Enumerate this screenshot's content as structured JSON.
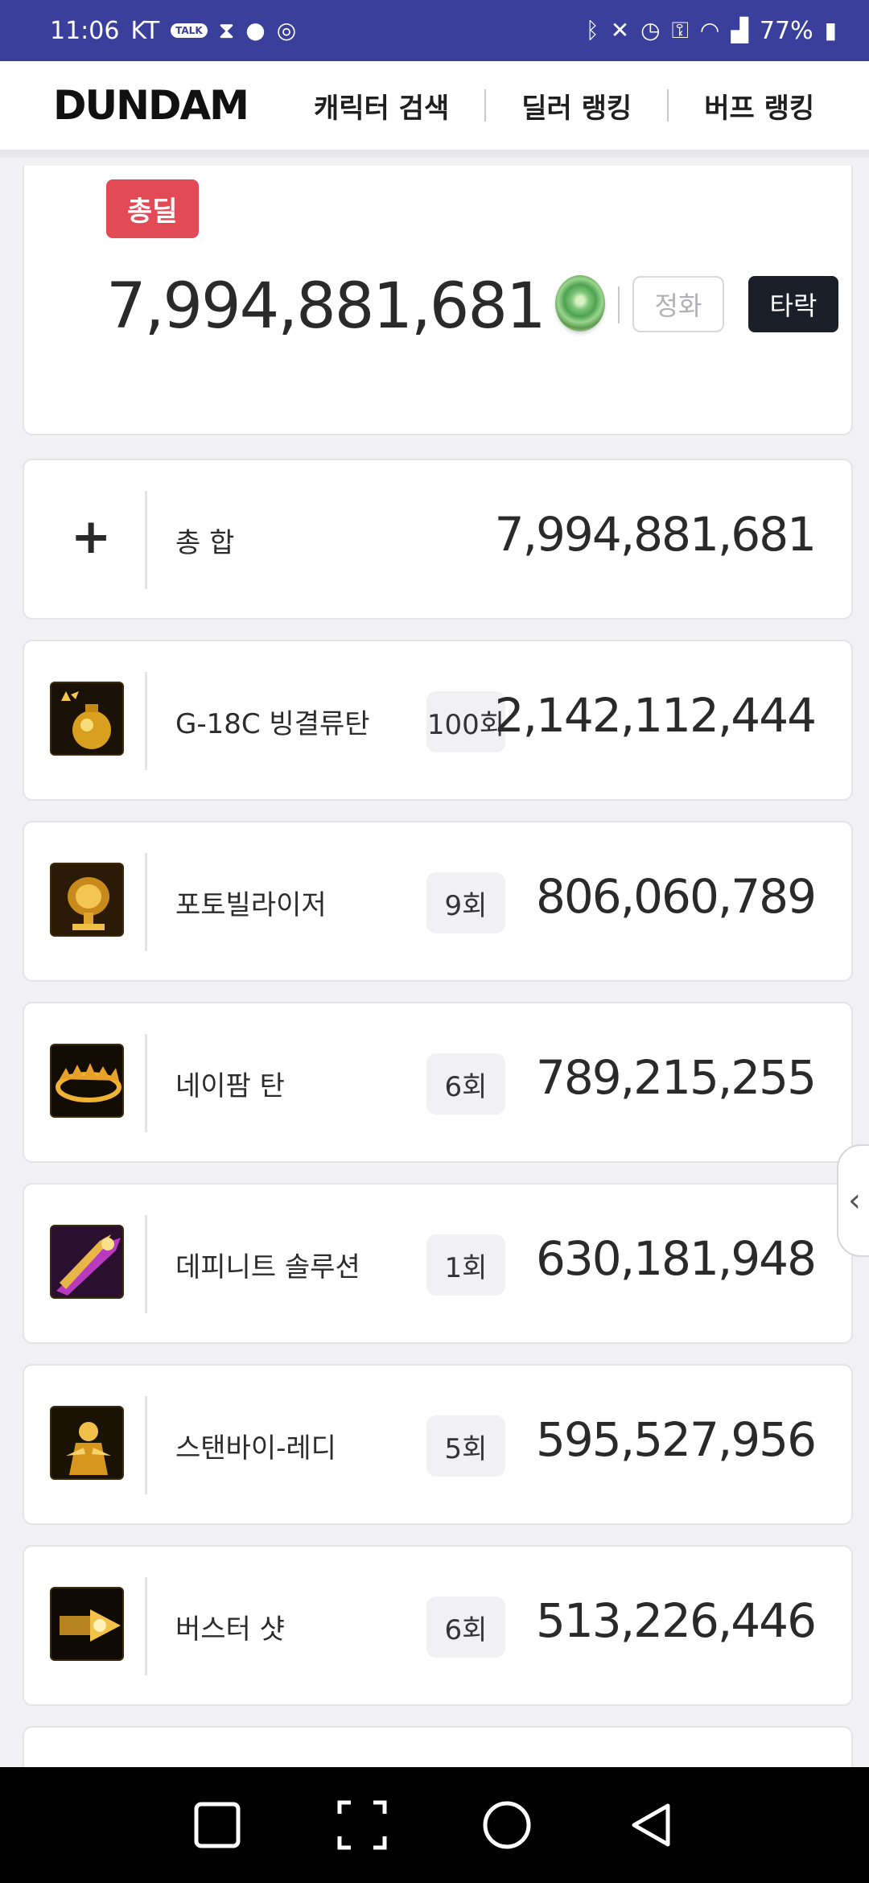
{
  "status_bar": {
    "time": "11:06",
    "carrier": "KT",
    "talk_badge": "TALK",
    "battery": "77%"
  },
  "nav": {
    "logo": "DUNDAM",
    "items": [
      "캐릭터 검색",
      "딜러 랭킹",
      "버프 랭킹"
    ]
  },
  "summary": {
    "badge": "총딜",
    "total": "7,994,881,681",
    "mode_buttons": {
      "jeonghwa": "정화",
      "tarak": "타락"
    }
  },
  "total_row": {
    "label": "총 합",
    "value": "7,994,881,681"
  },
  "skills": [
    {
      "name": "G-18C 빙결류탄",
      "count": "100회",
      "damage": "2,142,112,444",
      "icon": "grenade-skill-icon"
    },
    {
      "name": "포토빌라이저",
      "count": "9회",
      "damage": "806,060,789",
      "icon": "photobilizer-skill-icon"
    },
    {
      "name": "네이팜 탄",
      "count": "6회",
      "damage": "789,215,255",
      "icon": "napalm-skill-icon"
    },
    {
      "name": "데피니트 솔루션",
      "count": "1회",
      "damage": "630,181,948",
      "icon": "definite-solution-skill-icon"
    },
    {
      "name": "스탠바이-레디",
      "count": "5회",
      "damage": "595,527,956",
      "icon": "standby-ready-skill-icon"
    },
    {
      "name": "버스터 샷",
      "count": "6회",
      "damage": "513,226,446",
      "icon": "buster-shot-skill-icon"
    }
  ]
}
